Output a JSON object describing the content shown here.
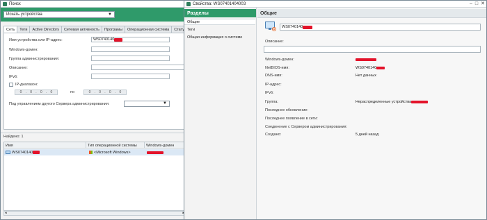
{
  "search_window": {
    "title": "Поиск",
    "search_type": "Искать устройства",
    "tabs": [
      "Сеть",
      "Теги",
      "Active Directory",
      "Сетевая активность",
      "Програмы",
      "Операционная система",
      "Статус устр"
    ],
    "form": {
      "name_ip_label": "Имя устройства или IP-адрес:",
      "name_ip_value": "WS0740140",
      "windows_domain_label": "Windows-домен:",
      "admin_group_label": "Группа администрирования:",
      "description_label": "Описание:",
      "ipv6_label": "IPv6:",
      "ip_range_label": "IP-диапазон:",
      "ip_from": [
        "0",
        "0",
        "0",
        "0"
      ],
      "ip_to_label": "по",
      "ip_to": [
        "0",
        "0",
        "0",
        "0"
      ],
      "managed_by_label": "Под управлением другого Сервера администрирования:"
    },
    "found_label": "Найдено: 1",
    "columns": [
      "Имя",
      "Тип операционной системы",
      "Windows-домен"
    ],
    "rows": [
      {
        "name": "WS0740140",
        "os": "<Microsoft Windows>",
        "domain": ""
      }
    ]
  },
  "properties_window": {
    "title": "Свойства: WS0740140400З",
    "sidebar_title": "Разделы",
    "sidebar_items": [
      "Общие",
      "Теги",
      "Общая информация о системе"
    ],
    "section_title": "Общие",
    "device_name": "WS0740140",
    "description_label": "Описание:",
    "props": [
      {
        "label": "Windows-домен:",
        "value": ""
      },
      {
        "label": "NetBIOS-имя:",
        "value": "WS0740140"
      },
      {
        "label": "DNS-имя:",
        "value": "Нет данных"
      },
      {
        "label": "IP-адрес:",
        "value": ""
      },
      {
        "label": "IPv6:",
        "value": ""
      },
      {
        "label": "Группа:",
        "value": "Нераспределенные устройства"
      },
      {
        "label": "Последнее обновление:",
        "value": ""
      },
      {
        "label": "Последнее появление в сети:",
        "value": ""
      },
      {
        "label": "Соединение с Сервером администрирования:",
        "value": ""
      },
      {
        "label": "Создано:",
        "value": "5 дней назад"
      }
    ]
  },
  "colors": {
    "accent_green": "#2f9a6a",
    "redaction": "#e3132a"
  }
}
